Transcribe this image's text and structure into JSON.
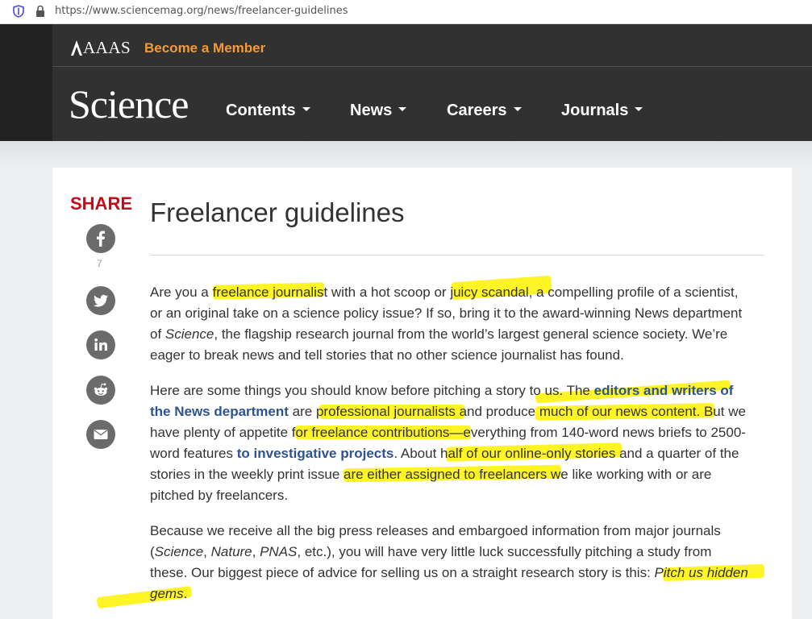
{
  "browser": {
    "url": "https://www.sciencemag.org/news/freelancer-guidelines"
  },
  "header": {
    "aaas_label": "AAAS",
    "member_label": "Become a Member",
    "wordmark": "Science",
    "nav": [
      {
        "label": "Contents"
      },
      {
        "label": "News"
      },
      {
        "label": "Careers"
      },
      {
        "label": "Journals"
      }
    ]
  },
  "share": {
    "label": "SHARE",
    "facebook_count": "7",
    "icons": [
      "facebook-icon",
      "twitter-icon",
      "linkedin-icon",
      "reddit-icon",
      "email-icon"
    ]
  },
  "article": {
    "title": "Freelancer guidelines",
    "p1": [
      "Are you a freelance journalist with a hot scoop or juicy scandal, a compelling profile of a scientist,",
      "or an original take on a science policy issue? If so, bring it to the award-winning News department",
      "of Science, the flagship research journal from the world’s largest general science society. We’re",
      "eager to break news and tell stories that no other science journalist has found."
    ],
    "p2": {
      "l1_pre": "Here are some things you should know before pitching a story to us. The ",
      "l1_link": "editors and writers of",
      "l2_link": "the News department",
      "l2_post": " are professional journalists and produce much of our news content. But we",
      "l3": "have plenty of appetite for freelance contributions—everything from 140-word news briefs to 2500-",
      "l4_pre": "word features ",
      "l4_link": "to investigative projects",
      "l4_post": ". About half of our online-only stories and a quarter of the",
      "l5": "stories in the weekly print issue are either assigned to freelancers we like working with or are",
      "l6": "pitched by freelancers."
    },
    "p3": {
      "l1": "Because we receive all the big press releases and embargoed information from major journals",
      "l2_a": "(",
      "l2_i1": "Science",
      "l2_b": ", ",
      "l2_i2": "Nature",
      "l2_c": ", ",
      "l2_i3": "PNAS",
      "l2_d": ", etc.), you will have very little luck successfully pitching a study from",
      "l3_pre": "these. Our biggest piece of advice for selling us on a straight research story is this: ",
      "l3_em": "Pitch us hidden",
      "l4_em": "gems",
      "l4_post": "."
    }
  },
  "colors": {
    "header_bg": "#313131",
    "member_orange": "#f39a37",
    "share_red": "#cc0a17",
    "link_blue": "#2d5390",
    "highlighter": "#fff200"
  }
}
